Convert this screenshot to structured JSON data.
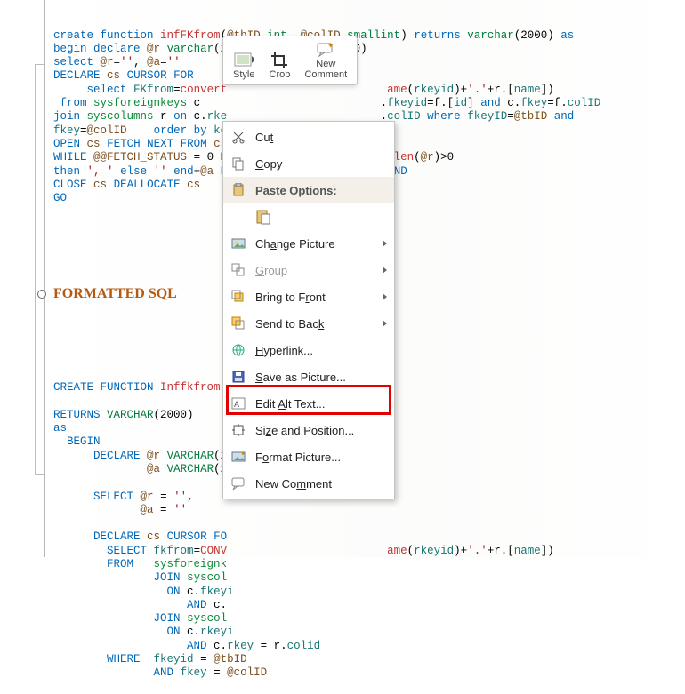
{
  "code": {
    "block1_lines": [
      "<span class='kw'>create function</span> <span class='fn'>infFKfrom</span>(<span class='var'>@tbID</span> <span class='ty'>int</span>, <span class='var'>@colID</span> <span class='ty'>smallint</span>) <span class='kw'>returns</span> <span class='ty'>varchar</span>(2000) <span class='kw'>as</span>",
      "<span class='kw'>begin declare</span> <span class='var'>@r</span> <span class='ty'>varchar</span>(2000), <span class='var'>@a</span> <span class='ty'>varchar</span>(200)",
      "<span class='kw'>select</span> <span class='var'>@r</span>=<span class='lit'>''</span>, <span class='var'>@a</span>=<span class='lit'>''</span>",
      "<span class='kw'>DECLARE</span> <span class='var'>cs</span> <span class='kw'>CURSOR FOR</span>",
      "     <span class='kw'>select</span> <span class='col'>FKfrom</span>=<span class='fn'>convert</span>                        <span class='fn'>ame</span>(<span class='col'>rkeyid</span>)+<span class='lit'>'.'</span>+r.[<span class='col'>name</span>])",
      " <span class='kw'>from</span> <span class='tbl'>sysforeignkeys</span> c                           .<span class='col'>fkeyid</span>=f.[<span class='col'>id</span>] <span class='kw'>and</span> c.<span class='col'>fkey</span>=f.<span class='col'>colID</span>",
      "<span class='kw'>join</span> <span class='tbl'>syscolumns</span> r <span class='kw'>on</span> c.<span class='col'>rke</span>                       .<span class='col'>colID</span> <span class='kw'>where</span> <span class='col'>fkeyID</span>=<span class='var'>@tbID</span> <span class='kw'>and</span>",
      "<span class='col'>fkey</span>=<span class='var'>@colID</span>    <span class='kw'>order by</span> <span class='col'>ke</span>",
      "<span class='kw'>OPEN</span> <span class='var'>cs</span> <span class='kw'>FETCH NEXT FROM</span> <span class='var'>cs</span> <span class='kw'>INTO</span> <span class='var'>@a</span>",
      "<span class='kw'>WHILE</span> <span class='var'>@@FETCH_STATUS</span> = 0 B                         <span class='fn'>len</span>(<span class='var'>@r</span>)&gt;0",
      "<span class='kw'>then</span> <span class='lit'>', '</span> <span class='kw'>else</span> <span class='lit'>''</span> <span class='kw'>end</span>+<span class='var'>@a</span> F                         <span class='kw'>ND</span>",
      "<span class='kw'>CLOSE</span> <span class='var'>cs</span> <span class='kw'>DEALLOCATE</span> <span class='var'>cs</span>",
      "<span class='kw'>GO</span>"
    ],
    "block2_lines": [
      "<span class='kw'>CREATE FUNCTION</span> <span class='fn'>Inffkfrom</span>(",
      "",
      "<span class='kw'>RETURNS</span> <span class='ty'>VARCHAR</span>(2000)",
      "<span class='kw'>as</span>",
      "  <span class='kw'>BEGIN</span>",
      "      <span class='kw'>DECLARE</span> <span class='var'>@r</span> <span class='ty'>VARCHAR</span>(2",
      "              <span class='var'>@a</span> <span class='ty'>VARCHAR</span>(2",
      "",
      "      <span class='kw'>SELECT</span> <span class='var'>@r</span> = <span class='lit'>''</span>,",
      "             <span class='var'>@a</span> = <span class='lit'>''</span>",
      "",
      "      <span class='kw'>DECLARE</span> <span class='var'>cs</span> <span class='kw'>CURSOR FO</span>",
      "        <span class='kw'>SELECT</span> <span class='col'>fkfrom</span>=<span class='fn'>CONV</span>                        <span class='fn'>ame</span>(<span class='col'>rkeyid</span>)+<span class='lit'>'.'</span>+r.[<span class='col'>name</span>])",
      "        <span class='kw'>FROM</span>   <span class='tbl'>sysforeignk</span>",
      "               <span class='kw'>JOIN</span> <span class='tbl'>syscol</span>",
      "                 <span class='kw'>ON</span> c.<span class='col'>fkeyi</span>",
      "                    <span class='kw'>AND</span> c.",
      "               <span class='kw'>JOIN</span> <span class='tbl'>syscol</span>",
      "                 <span class='kw'>ON</span> c.<span class='col'>rkeyi</span>",
      "                    <span class='kw'>AND</span> c.<span class='col'>rkey</span> = r.<span class='col'>colid</span>",
      "        <span class='kw'>WHERE</span>  <span class='col'>fkeyid</span> = <span class='var'>@tbID</span>",
      "               <span class='kw'>AND</span> <span class='col'>fkey</span> = <span class='var'>@colID</span>"
    ]
  },
  "heading": "FORMATTED SQL",
  "toolbar": {
    "style": "Style",
    "crop": "Crop",
    "new_comment_l1": "New",
    "new_comment_l2": "Comment"
  },
  "menu": {
    "cut": "Cut",
    "copy": "Copy",
    "paste_options": "Paste Options:",
    "change_picture": "Change Picture",
    "group": "Group",
    "bring_front": "Bring to Front",
    "send_back": "Send to Back",
    "hyperlink": "Hyperlink...",
    "save_picture": "Save as Picture...",
    "alt_text": "Edit Alt Text...",
    "size_pos": "Size and Position...",
    "format_picture": "Format Picture...",
    "new_comment": "New Comment"
  }
}
